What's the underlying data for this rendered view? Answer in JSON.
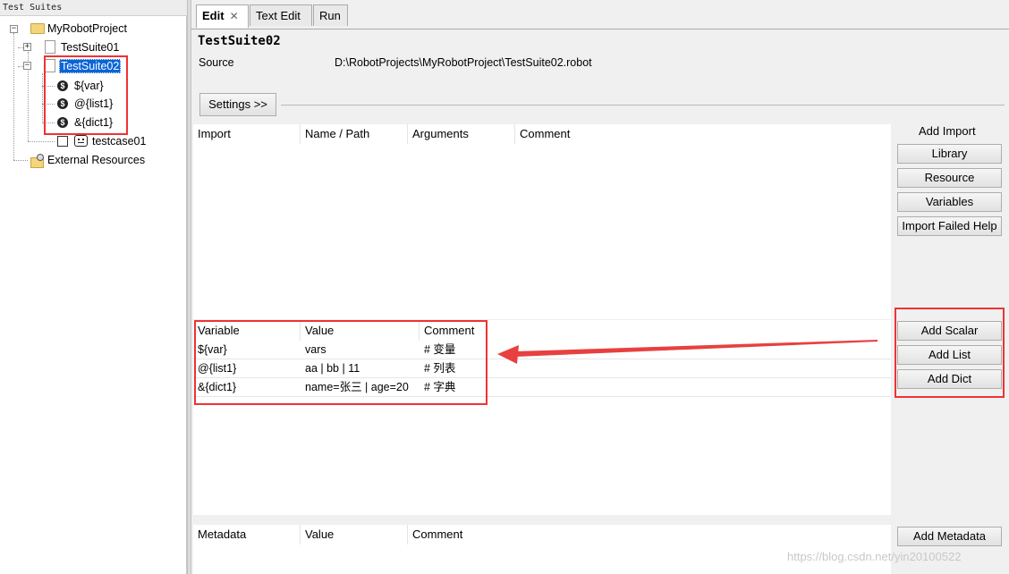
{
  "tree": {
    "header": "Test Suites",
    "project": "MyRobotProject",
    "suite1": "TestSuite01",
    "suite2": "TestSuite02",
    "var_scalar": "${var}",
    "var_list": "@{list1}",
    "var_dict": "&{dict1}",
    "testcase": "testcase01",
    "external": "External Resources"
  },
  "tabs": [
    "Edit",
    "Text Edit",
    "Run"
  ],
  "suite": {
    "title": "TestSuite02",
    "source_label": "Source",
    "source_path": "D:\\RobotProjects\\MyRobotProject\\TestSuite02.robot",
    "settings_button": "Settings >>"
  },
  "imports": {
    "headers": [
      "Import",
      "Name / Path",
      "Arguments",
      "Comment"
    ],
    "add_label": "Add Import",
    "buttons": [
      "Library",
      "Resource",
      "Variables",
      "Import Failed Help"
    ]
  },
  "variables": {
    "headers": [
      "Variable",
      "Value",
      "Comment"
    ],
    "rows": [
      {
        "name": "${var}",
        "value": "vars",
        "comment": "# 变量"
      },
      {
        "name": "@{list1}",
        "value": "aa | bb | 11",
        "comment": "# 列表"
      },
      {
        "name": "&{dict1}",
        "value": "name=张三 | age=20",
        "comment": "# 字典"
      }
    ],
    "buttons": [
      "Add Scalar",
      "Add List",
      "Add Dict"
    ]
  },
  "metadata": {
    "headers": [
      "Metadata",
      "Value",
      "Comment"
    ],
    "add_button": "Add Metadata"
  },
  "watermark": "https://blog.csdn.net/yin20100522",
  "colors": {
    "selection": "#0a64d6",
    "highlight": "#e33333"
  }
}
